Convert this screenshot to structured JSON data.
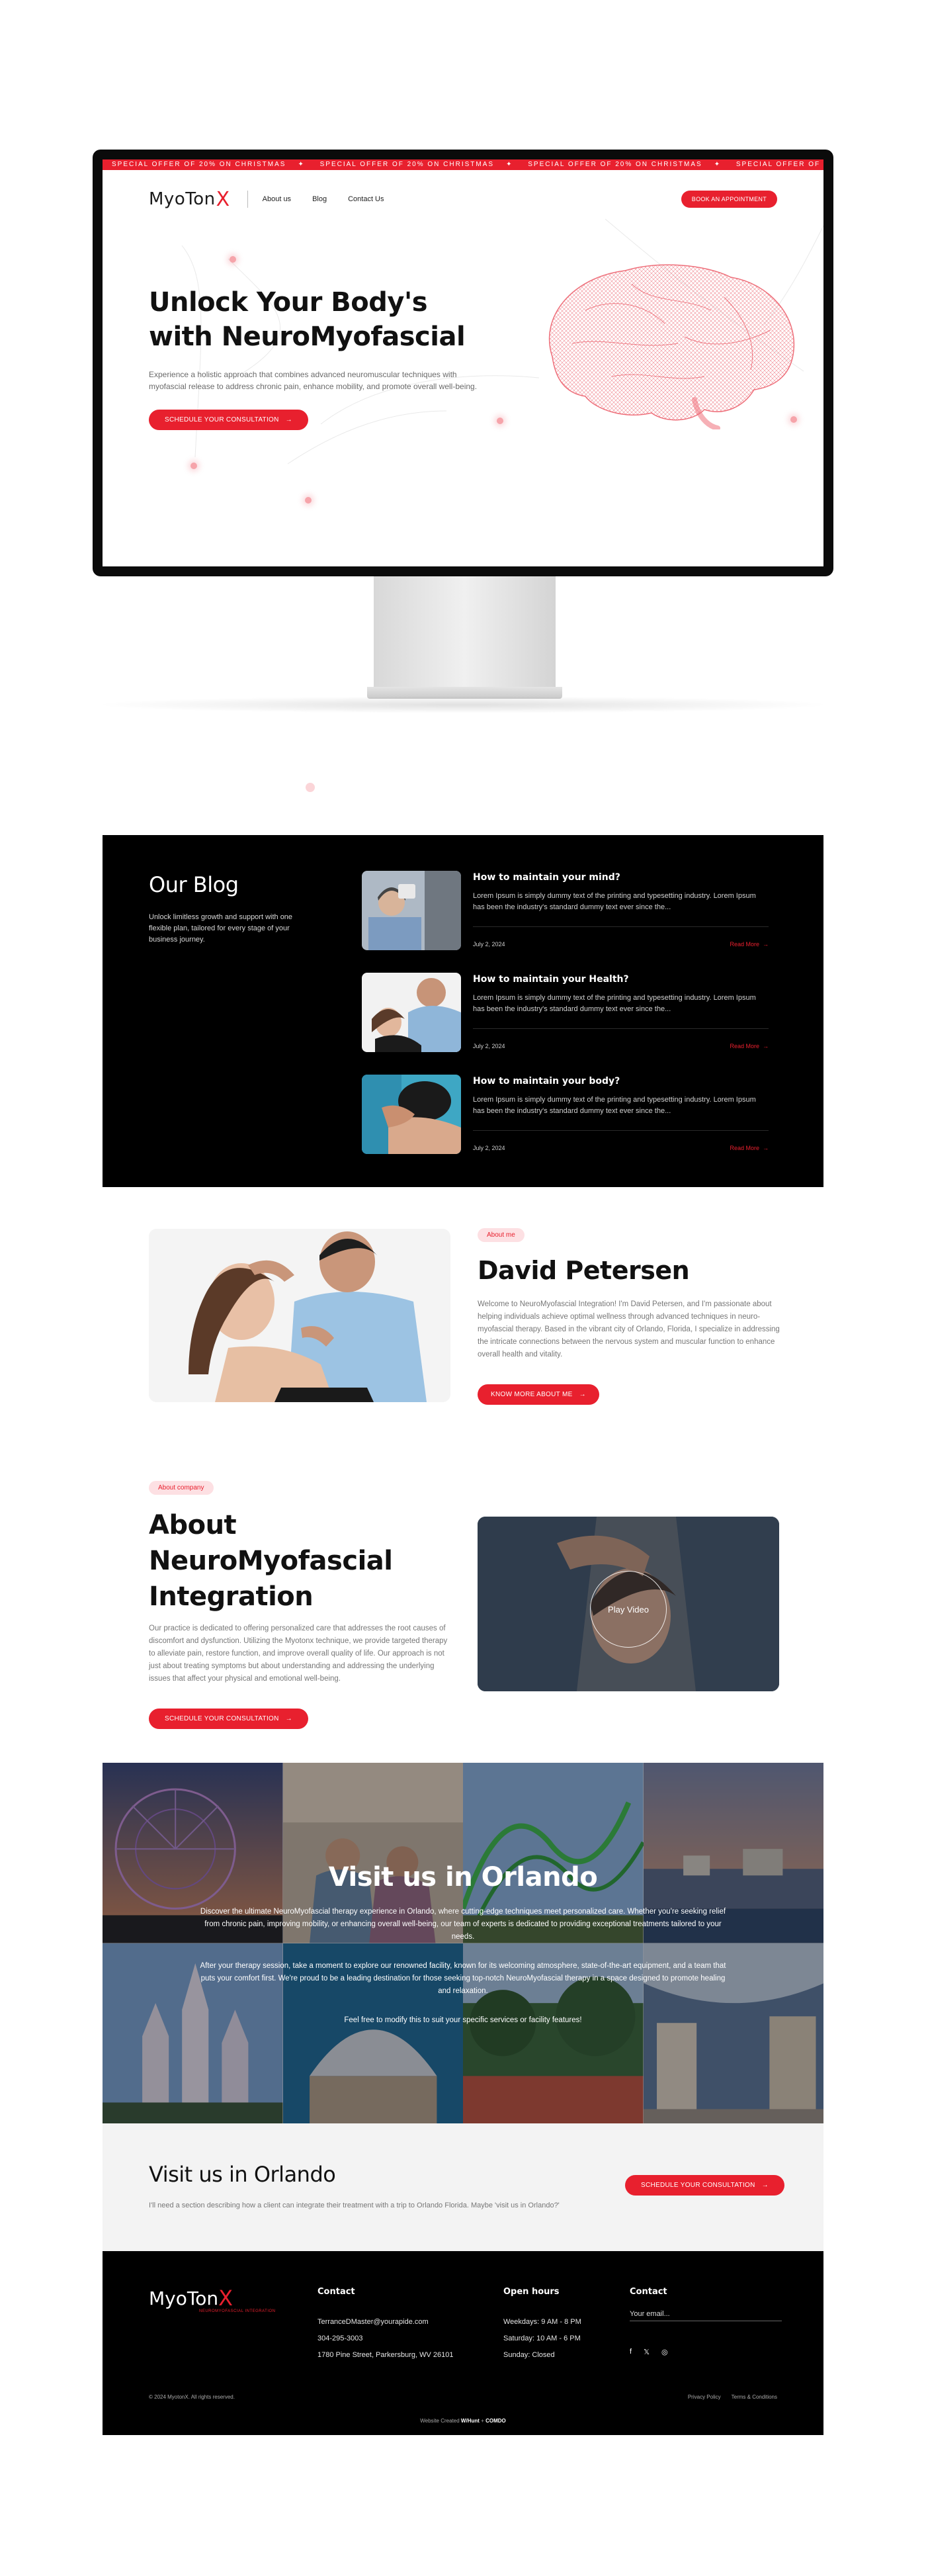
{
  "ticker": {
    "text": "SPECIAL OFFER OF 20% ON CHRISTMAS",
    "separator": "✦"
  },
  "brand": {
    "logo_main": "MyoTon",
    "logo_x": "X",
    "logo_tagline": "NEUROMYOFASCIAL INTEGRATION",
    "accent_color": "#e8202e"
  },
  "nav": {
    "links": [
      "About us",
      "Blog",
      "Contact Us"
    ],
    "cta": "BOOK AN APPOINTMENT"
  },
  "hero": {
    "title_line1": "Unlock Your Body's",
    "title_line2": "with NeuroMyofascial",
    "subtitle": "Experience a holistic approach that combines advanced neuromuscular techniques with myofascial release to address chronic pain, enhance mobility, and promote overall well-being.",
    "cta": "SCHEDULE YOUR CONSULTATION"
  },
  "blog": {
    "title": "Our Blog",
    "subtitle": "Unlock limitless growth and support with one flexible plan, tailored for every stage of your business journey.",
    "posts": [
      {
        "title": "How to maintain your mind?",
        "text": "Lorem Ipsum is simply dummy text of the printing and typesetting industry. Lorem Ipsum has been the industry's standard dummy text ever since the...",
        "date": "July 2, 2024",
        "more": "Read More"
      },
      {
        "title": "How to maintain your Health?",
        "text": "Lorem Ipsum is simply dummy text of the printing and typesetting industry. Lorem Ipsum has been the industry's standard dummy text ever since the...",
        "date": "July 2, 2024",
        "more": "Read More"
      },
      {
        "title": "How to maintain your body?",
        "text": "Lorem Ipsum is simply dummy text of the printing and typesetting industry. Lorem Ipsum has been the industry's standard dummy text ever since the...",
        "date": "July 2, 2024",
        "more": "Read More"
      }
    ]
  },
  "about_me": {
    "pill": "About me",
    "name": "David Petersen",
    "text": "Welcome to NeuroMyofascial Integration! I'm David Petersen, and I'm passionate about helping individuals achieve optimal wellness through advanced techniques in neuro-myofascial therapy. Based in the vibrant city of Orlando, Florida, I specialize in addressing the intricate connections between the nervous system and muscular function to enhance overall health and vitality.",
    "cta": "KNOW MORE ABOUT ME"
  },
  "about_company": {
    "pill": "About company",
    "title_line1": "About",
    "title_line2": "NeuroMyofascial",
    "title_line3": "Integration",
    "text": "Our practice is dedicated to offering personalized care that addresses the root causes of discomfort and dysfunction. Utilizing the Myotonx technique, we provide targeted therapy to alleviate pain, restore function, and improve overall quality of life. Our approach is not just about treating symptoms but about understanding and addressing the underlying issues that affect your physical and emotional well-being.",
    "cta": "SCHEDULE YOUR CONSULTATION",
    "video_label": "Play Video"
  },
  "orlando": {
    "title": "Visit us in Orlando",
    "p1": "Discover the ultimate NeuroMyofascial therapy experience in Orlando, where cutting-edge techniques meet personalized care. Whether you're seeking relief from chronic pain, improving mobility, or enhancing overall well-being, our team of experts is dedicated to providing exceptional treatments tailored to your needs.",
    "p2": "After your therapy session, take a moment to explore our renowned facility, known for its welcoming atmosphere, state-of-the-art equipment, and a team that puts your comfort first. We're proud to be a leading destination for those seeking top-notch NeuroMyofascial therapy in a space designed to promote healing and relaxation.",
    "p3": "Feel free to modify this to suit your specific services or facility features!"
  },
  "visit_band": {
    "title": "Visit us in Orlando",
    "text": "I'll need a section describing how a client can integrate their treatment with a trip to Orlando Florida. Maybe 'visit us in Orlando?'",
    "cta": "SCHEDULE YOUR CONSULTATION"
  },
  "footer": {
    "contact_title": "Contact",
    "email": "TerranceDMaster@yourapide.com",
    "phone": "304-295-3003",
    "address": "1780 Pine Street, Parkersburg, WV 26101",
    "hours_title": "Open hours",
    "hours": [
      "Weekdays: 9 AM - 8 PM",
      "Saturday: 10 AM - 6 PM",
      "Sunday: Closed"
    ],
    "newsletter_title": "Contact",
    "email_placeholder": "Your email...",
    "copyright": "© 2024 MyotonX. All rights reserved.",
    "legal": [
      "Privacy Policy",
      "Terms & Conditions"
    ],
    "credit_prefix": "Website Created",
    "credit_by": "W/Hunt",
    "credit_and": "+",
    "credit_studio": "COMDO"
  }
}
